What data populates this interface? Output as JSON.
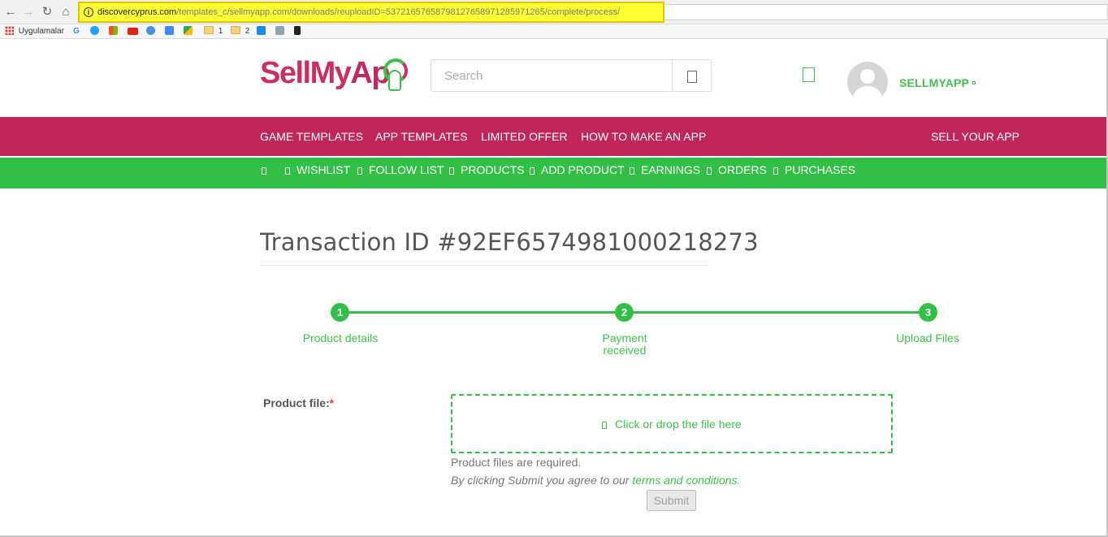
{
  "browser": {
    "url_domain": "discovercyprus.com",
    "url_path": "/templates_c/sellmyapp.com/downloads/reuploadID=537216576587981276589712859712 65/complete/process/",
    "url_path_exact": "/templates_c/sellmyapp.com/downloads/reuploadID=53721657658798127658971285971265/complete/process/",
    "bookmarks": [
      "Uygulamalar",
      "1",
      "2"
    ]
  },
  "header": {
    "logo_text": {
      "sell": "Sell",
      "my": "My",
      "app": "Ap"
    },
    "search_placeholder": "Search",
    "username": "SELLMYAPP"
  },
  "main_nav": [
    "GAME TEMPLATES",
    "APP TEMPLATES",
    "LIMITED OFFER",
    "HOW TO MAKE AN APP",
    "SELL YOUR APP"
  ],
  "sub_nav": [
    "WISHLIST",
    "FOLLOW LIST",
    "PRODUCTS",
    "ADD PRODUCT",
    "EARNINGS",
    "ORDERS",
    "PURCHASES"
  ],
  "content": {
    "title": "Transaction ID #92EF6574981000218273",
    "steps": [
      {
        "number": "1",
        "label": "Product details"
      },
      {
        "number": "2",
        "label": "Payment received"
      },
      {
        "number": "3",
        "label": "Upload Files"
      }
    ],
    "field_label": "Product file:",
    "required_mark": "*",
    "dropzone_text": "Click or drop the file here",
    "help_text": "Product files are required.",
    "agree_prefix": "By clicking Submit you agree to our ",
    "agree_link": "terms and conditions.",
    "submit_label": "Submit"
  },
  "colors": {
    "brand_pink": "#c0265a",
    "brand_green": "#32bf46",
    "url_highlight": "#ffff33"
  }
}
